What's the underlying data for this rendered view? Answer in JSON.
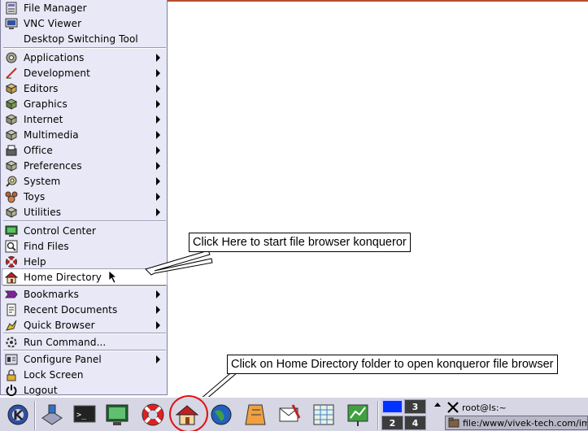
{
  "menu": {
    "items": [
      {
        "label": "File Manager",
        "icon": "file-manager-icon"
      },
      {
        "label": "VNC Viewer",
        "icon": "vnc-viewer-icon"
      },
      {
        "label": "Desktop Switching Tool",
        "icon": ""
      },
      {
        "label": "Applications",
        "icon": "applications-icon",
        "submenu": true
      },
      {
        "label": "Development",
        "icon": "development-icon",
        "submenu": true
      },
      {
        "label": "Editors",
        "icon": "editors-icon",
        "submenu": true
      },
      {
        "label": "Graphics",
        "icon": "graphics-icon",
        "submenu": true
      },
      {
        "label": "Internet",
        "icon": "internet-icon",
        "submenu": true
      },
      {
        "label": "Multimedia",
        "icon": "multimedia-icon",
        "submenu": true
      },
      {
        "label": "Office",
        "icon": "office-icon",
        "submenu": true
      },
      {
        "label": "Preferences",
        "icon": "preferences-icon",
        "submenu": true
      },
      {
        "label": "System",
        "icon": "system-icon",
        "submenu": true
      },
      {
        "label": "Toys",
        "icon": "toys-icon",
        "submenu": true
      },
      {
        "label": "Utilities",
        "icon": "utilities-icon",
        "submenu": true
      },
      {
        "label": "Control Center",
        "icon": "control-center-icon"
      },
      {
        "label": "Find Files",
        "icon": "find-files-icon"
      },
      {
        "label": "Help",
        "icon": "help-lifebuoy-icon"
      },
      {
        "label": "Home Directory",
        "icon": "home-directory-icon",
        "selected": true
      },
      {
        "label": "Bookmarks",
        "icon": "bookmarks-icon",
        "submenu": true
      },
      {
        "label": "Recent Documents",
        "icon": "recent-documents-icon",
        "submenu": true
      },
      {
        "label": "Quick Browser",
        "icon": "quick-browser-icon",
        "submenu": true
      },
      {
        "label": "Run Command...",
        "icon": "run-command-icon"
      },
      {
        "label": "Configure Panel",
        "icon": "configure-panel-icon",
        "submenu": true
      },
      {
        "label": "Lock Screen",
        "icon": "lock-screen-icon"
      },
      {
        "label": "Logout",
        "icon": "logout-icon"
      }
    ]
  },
  "callouts": {
    "konqueror": "Click Here to start file browser konqueror",
    "home_folder": "Click on Home Directory folder to open konqueror file browser"
  },
  "pager": {
    "desktops": [
      "1",
      "3",
      "2",
      "4"
    ],
    "active": "1"
  },
  "tasks": [
    {
      "label": "root@ls:~",
      "icon": "x-terminal-icon"
    },
    {
      "label": "file:/www/vivek-tech.com/images",
      "icon": "konqueror-folder-icon",
      "active": true
    }
  ],
  "colors": {
    "menu_bg": "#e8e8f6",
    "callout_circle": "#e01010",
    "panel_bg": "#d6d6e4"
  }
}
